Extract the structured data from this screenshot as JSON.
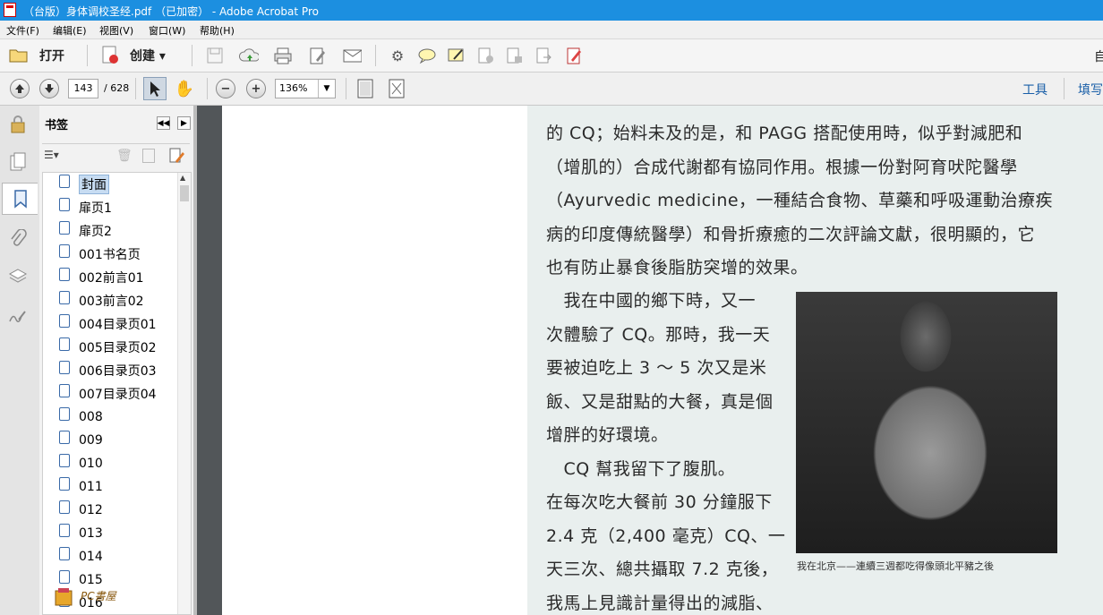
{
  "window": {
    "title": "（台版）身体调校圣经.pdf （已加密） - Adobe Acrobat Pro"
  },
  "menu": [
    "文件(F)",
    "编辑(E)",
    "视图(V)",
    "窗口(W)",
    "帮助(H)"
  ],
  "toolbar1": {
    "open_label": "打开",
    "create_label": "创建 ▾",
    "right_edge_text": "自"
  },
  "toolbar2": {
    "page_number": "143",
    "page_total": "/ 628",
    "zoom": "136%",
    "tools_label": "工具",
    "fill_sign_label": "填写"
  },
  "bookmarks_panel": {
    "title": "书签",
    "items": [
      "封面",
      "扉页1",
      "扉页2",
      "001书名页",
      "002前言01",
      "003前言02",
      "004目录页01",
      "005目录页02",
      "006目录页03",
      "007目录页04",
      "008",
      "009",
      "010",
      "011",
      "012",
      "013",
      "014",
      "015",
      "016"
    ],
    "selected_index": 0
  },
  "document": {
    "lines_full": [
      "的 CQ；始料未及的是，和 PAGG 搭配使用時，似乎對減肥和",
      "（增肌的）合成代謝都有協同作用。根據一份對阿育吠陀醫學",
      "（Ayurvedic medicine，一種結合食物、草藥和呼吸運動治療疾",
      "病的印度傳統醫學）和骨折療癒的二次評論文獻，很明顯的，它",
      "也有防止暴食後脂肪突增的效果。"
    ],
    "lines_narrow": [
      "　我在中國的鄉下時，又一",
      "次體驗了 CQ。那時，我一天",
      "要被迫吃上 3 ～ 5 次又是米",
      "飯、又是甜點的大餐，真是個",
      "增胖的好環境。",
      "　CQ 幫我留下了腹肌。",
      "在每次吃大餐前 30 分鐘服下",
      "2.4 克（2,400 毫克）CQ、一",
      "天三次、總共攝取 7.2 克後，",
      "我馬上見識計量得出的減脂、"
    ],
    "photo_caption": "我在北京——連續三週都吃得像頭北平豬之後"
  },
  "watermark": {
    "text": "PC書屋"
  }
}
